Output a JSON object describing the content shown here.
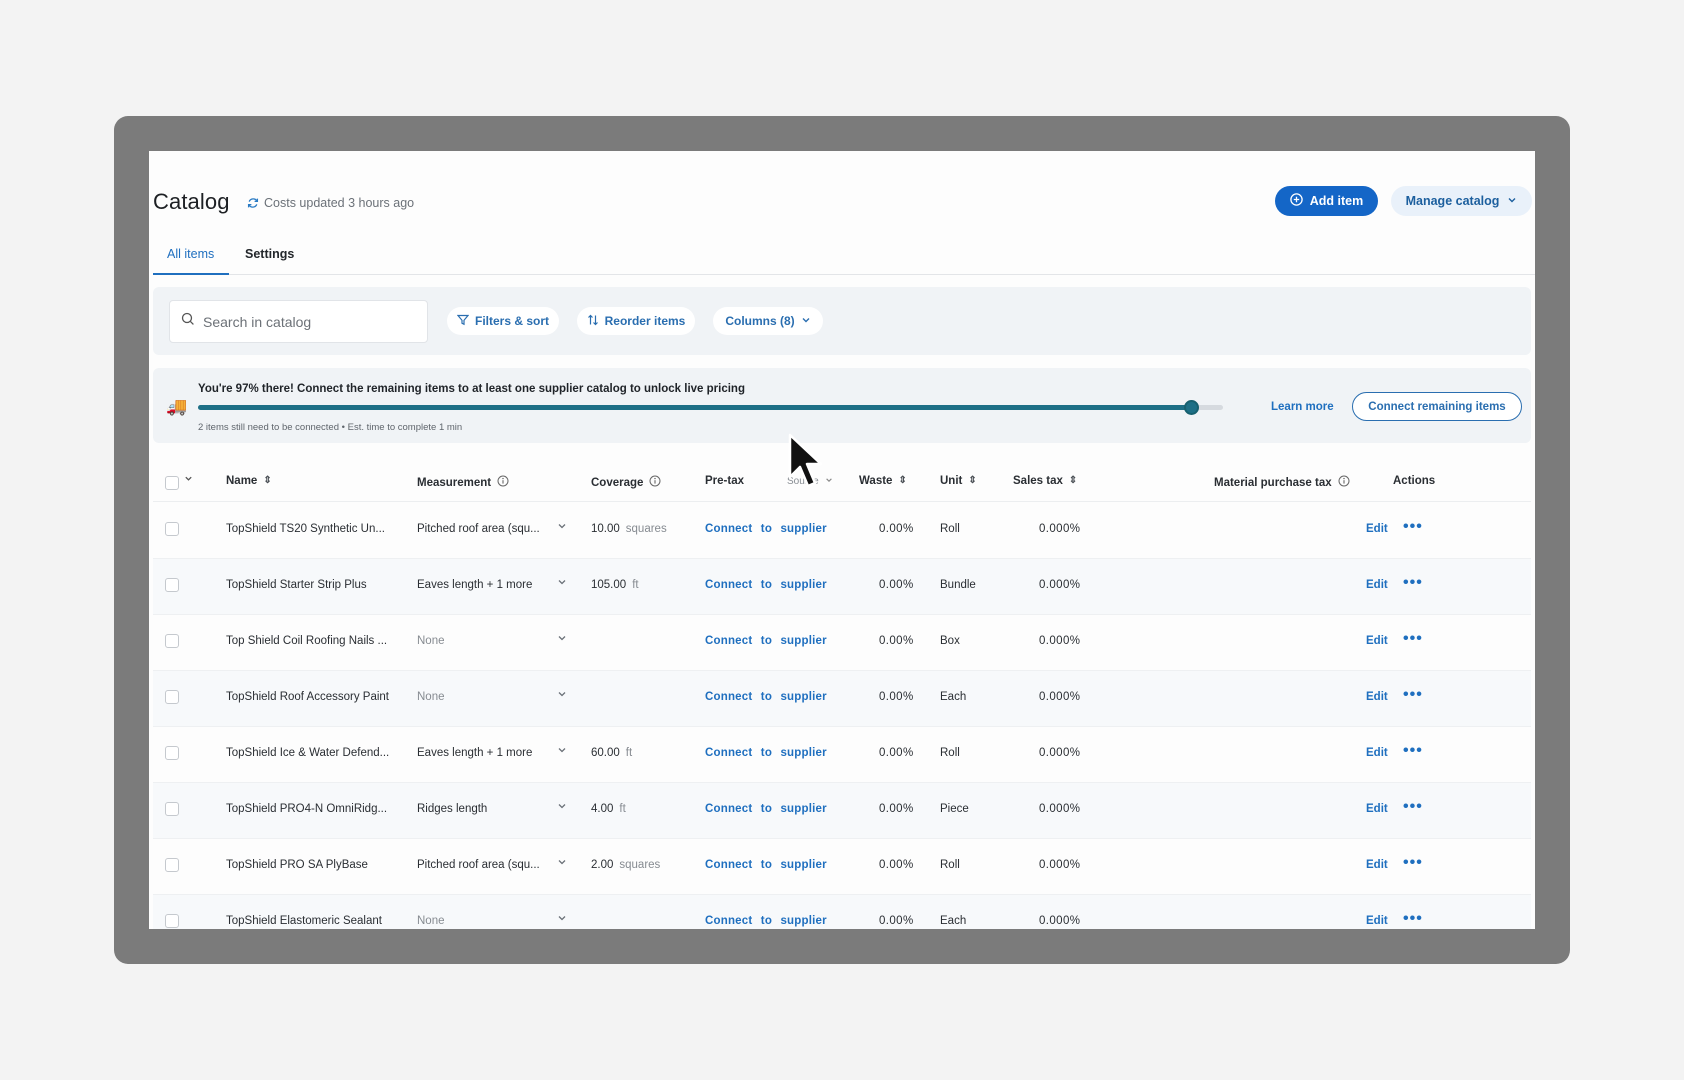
{
  "header": {
    "title": "Catalog",
    "updated": "Costs updated 3 hours ago",
    "add_item": "Add item",
    "manage_catalog": "Manage catalog"
  },
  "tabs": [
    "All items",
    "Settings"
  ],
  "toolbar": {
    "search_placeholder": "Search in catalog",
    "filters": "Filters & sort",
    "reorder": "Reorder items",
    "columns": "Columns (8)"
  },
  "banner": {
    "message": "You're 97% there! Connect the remaining items to at least one supplier catalog to unlock live pricing",
    "progress_percent": 97,
    "sub": "2 items still need to be connected • Est. time to complete 1 min",
    "learn_more": "Learn more",
    "connect_remaining": "Connect remaining items"
  },
  "table": {
    "headers": {
      "name": "Name",
      "measurement": "Measurement",
      "coverage": "Coverage",
      "pretax": "Pre-tax",
      "source": "Source",
      "waste": "Waste",
      "unit": "Unit",
      "sales_tax": "Sales tax",
      "material_tax": "Material purchase tax",
      "actions": "Actions"
    },
    "rows": [
      {
        "name": "TopShield TS20 Synthetic Un...",
        "measurement": "Pitched roof area (squ...",
        "coverage": "10.00",
        "coverage_unit": "squares",
        "pretax": "Connect to supplier",
        "waste": "0.00%",
        "unit": "Roll",
        "sales_tax": "0.000%",
        "edit": "Edit"
      },
      {
        "name": "TopShield Starter Strip Plus",
        "measurement": "Eaves length + 1 more",
        "coverage": "105.00",
        "coverage_unit": "ft",
        "pretax": "Connect to supplier",
        "waste": "0.00%",
        "unit": "Bundle",
        "sales_tax": "0.000%",
        "edit": "Edit"
      },
      {
        "name": "Top Shield Coil Roofing Nails ...",
        "measurement": "None",
        "coverage": "",
        "coverage_unit": "",
        "pretax": "Connect to supplier",
        "waste": "0.00%",
        "unit": "Box",
        "sales_tax": "0.000%",
        "edit": "Edit"
      },
      {
        "name": "TopShield Roof Accessory Paint",
        "measurement": "None",
        "coverage": "",
        "coverage_unit": "",
        "pretax": "Connect to supplier",
        "waste": "0.00%",
        "unit": "Each",
        "sales_tax": "0.000%",
        "edit": "Edit"
      },
      {
        "name": "TopShield Ice & Water Defend...",
        "measurement": "Eaves length + 1 more",
        "coverage": "60.00",
        "coverage_unit": "ft",
        "pretax": "Connect to supplier",
        "waste": "0.00%",
        "unit": "Roll",
        "sales_tax": "0.000%",
        "edit": "Edit"
      },
      {
        "name": "TopShield PRO4-N OmniRidg...",
        "measurement": "Ridges length",
        "coverage": "4.00",
        "coverage_unit": "ft",
        "pretax": "Connect to supplier",
        "waste": "0.00%",
        "unit": "Piece",
        "sales_tax": "0.000%",
        "edit": "Edit"
      },
      {
        "name": "TopShield PRO SA PlyBase",
        "measurement": "Pitched roof area (squ...",
        "coverage": "2.00",
        "coverage_unit": "squares",
        "pretax": "Connect to supplier",
        "waste": "0.00%",
        "unit": "Roll",
        "sales_tax": "0.000%",
        "edit": "Edit"
      },
      {
        "name": "TopShield Elastomeric Sealant",
        "measurement": "None",
        "coverage": "",
        "coverage_unit": "",
        "pretax": "Connect to supplier",
        "waste": "0.00%",
        "unit": "Each",
        "sales_tax": "0.000%",
        "edit": "Edit"
      }
    ]
  },
  "colors": {
    "accent": "#1466c7",
    "progress": "#1d6f86",
    "frame": "#7b7b7b"
  }
}
